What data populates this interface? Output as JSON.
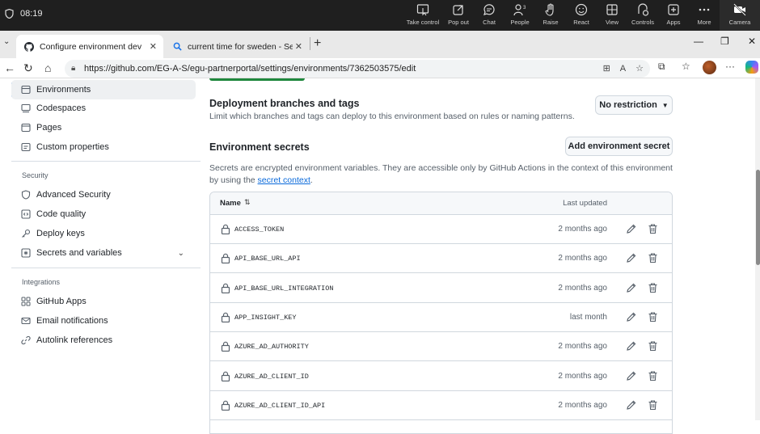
{
  "teams": {
    "time": "08:19",
    "tools": [
      {
        "label": "Take control",
        "icon": "take-control-icon"
      },
      {
        "label": "Pop out",
        "icon": "pop-out-icon"
      },
      {
        "label": "Chat",
        "icon": "chat-icon"
      },
      {
        "label": "People",
        "icon": "people-icon",
        "badge": "3"
      },
      {
        "label": "Raise",
        "icon": "raise-hand-icon"
      },
      {
        "label": "React",
        "icon": "react-icon"
      },
      {
        "label": "View",
        "icon": "view-icon"
      },
      {
        "label": "Controls",
        "icon": "controls-icon"
      },
      {
        "label": "Apps",
        "icon": "apps-icon"
      },
      {
        "label": "More",
        "icon": "more-icon"
      },
      {
        "label": "Camera",
        "icon": "camera-icon"
      }
    ]
  },
  "browser": {
    "tabs": [
      {
        "title": "Configure environment dev · EG-A-S",
        "icon": "github-icon",
        "active": true
      },
      {
        "title": "current time for sweden - Search",
        "icon": "search-icon",
        "active": false
      }
    ],
    "url": "https://github.com/EG-A-S/egu-partnerportal/settings/environments/7362503575/edit"
  },
  "sidebar": {
    "items_top": [
      {
        "label": "Environments",
        "icon": "environments-icon",
        "active": true
      },
      {
        "label": "Codespaces",
        "icon": "codespaces-icon"
      },
      {
        "label": "Pages",
        "icon": "pages-icon"
      },
      {
        "label": "Custom properties",
        "icon": "custom-properties-icon"
      }
    ],
    "security_heading": "Security",
    "security_items": [
      {
        "label": "Advanced Security",
        "icon": "shield-icon"
      },
      {
        "label": "Code quality",
        "icon": "code-quality-icon"
      },
      {
        "label": "Deploy keys",
        "icon": "key-icon"
      },
      {
        "label": "Secrets and variables",
        "icon": "secrets-icon"
      }
    ],
    "integrations_heading": "Integrations",
    "integrations_items": [
      {
        "label": "GitHub Apps",
        "icon": "apps-grid-icon"
      },
      {
        "label": "Email notifications",
        "icon": "mail-icon"
      },
      {
        "label": "Autolink references",
        "icon": "link-icon"
      }
    ]
  },
  "main": {
    "deploy_title": "Deployment branches and tags",
    "deploy_desc": "Limit which branches and tags can deploy to this environment based on rules or naming patterns.",
    "deploy_button": "No restriction",
    "secrets_title": "Environment secrets",
    "add_secret_button": "Add environment secret",
    "secrets_desc_1": "Secrets are encrypted environment variables. They are accessible only by GitHub Actions in the context of this environment",
    "secrets_desc_2": "by using the",
    "secrets_link": "secret context",
    "secrets_desc_end": ".",
    "table": {
      "col_name": "Name",
      "col_updated": "Last updated",
      "rows": [
        {
          "name": "ACCESS_TOKEN",
          "updated": "2 months ago"
        },
        {
          "name": "API_BASE_URL_API",
          "updated": "2 months ago"
        },
        {
          "name": "API_BASE_URL_INTEGRATION",
          "updated": "2 months ago"
        },
        {
          "name": "APP_INSIGHT_KEY",
          "updated": "last month"
        },
        {
          "name": "AZURE_AD_AUTHORITY",
          "updated": "2 months ago"
        },
        {
          "name": "AZURE_AD_CLIENT_ID",
          "updated": "2 months ago"
        },
        {
          "name": "AZURE_AD_CLIENT_ID_API",
          "updated": "2 months ago"
        }
      ]
    }
  }
}
